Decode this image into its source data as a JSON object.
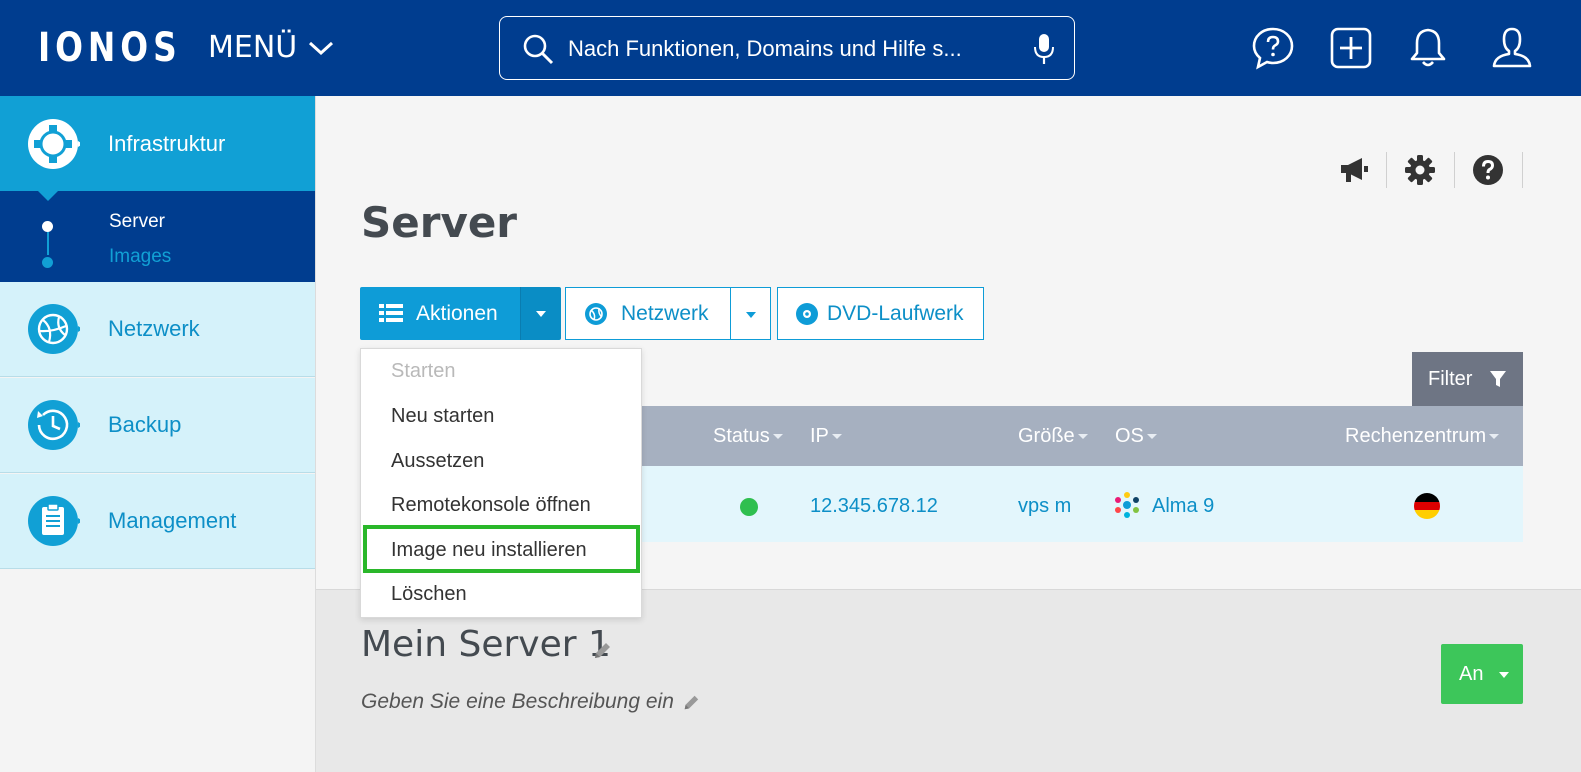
{
  "header": {
    "logo": "IONOS",
    "menu_label": "MENÜ",
    "search_placeholder": "Nach Funktionen, Domains und Hilfe s..."
  },
  "sidebar": {
    "active": {
      "label": "Infrastruktur",
      "icon": "infrastructure-icon"
    },
    "sub_items": [
      {
        "label": "Server",
        "active": true
      },
      {
        "label": "Images",
        "active": false
      }
    ],
    "items": [
      {
        "label": "Netzwerk",
        "icon": "network-globe-icon"
      },
      {
        "label": "Backup",
        "icon": "backup-clock-icon"
      },
      {
        "label": "Management",
        "icon": "clipboard-icon"
      }
    ]
  },
  "main": {
    "title": "Server",
    "toolbar": {
      "actions_label": "Aktionen",
      "network_label": "Netzwerk",
      "dvd_label": "DVD-Laufwerk"
    },
    "actions_menu": [
      {
        "label": "Starten",
        "disabled": true
      },
      {
        "label": "Neu starten",
        "disabled": false
      },
      {
        "label": "Aussetzen",
        "disabled": false
      },
      {
        "label": "Remotekonsole öffnen",
        "disabled": false
      },
      {
        "label": "Image neu installieren",
        "disabled": false,
        "highlighted": true
      },
      {
        "label": "Löschen",
        "disabled": false
      }
    ],
    "filter_label": "Filter",
    "table": {
      "columns": [
        "Status",
        "IP",
        "Größe",
        "OS",
        "Rechenzentrum"
      ],
      "rows": [
        {
          "status": "running",
          "ip": "12.345.678.12",
          "size": "vps m",
          "os": "Alma 9",
          "datacenter": "DE"
        }
      ]
    },
    "server_detail": {
      "name": "Mein Server 1",
      "description_placeholder": "Geben Sie eine Beschreibung ein",
      "power_label": "An"
    }
  },
  "colors": {
    "header_bg": "#003d8f",
    "accent": "#0e9cd7",
    "sidebar_active": "#11a0d5",
    "sidebar_item_bg": "#d5f2fa",
    "highlight_border": "#2ab72a",
    "status_green": "#2fbf4f",
    "power_button": "#3dc65a"
  }
}
